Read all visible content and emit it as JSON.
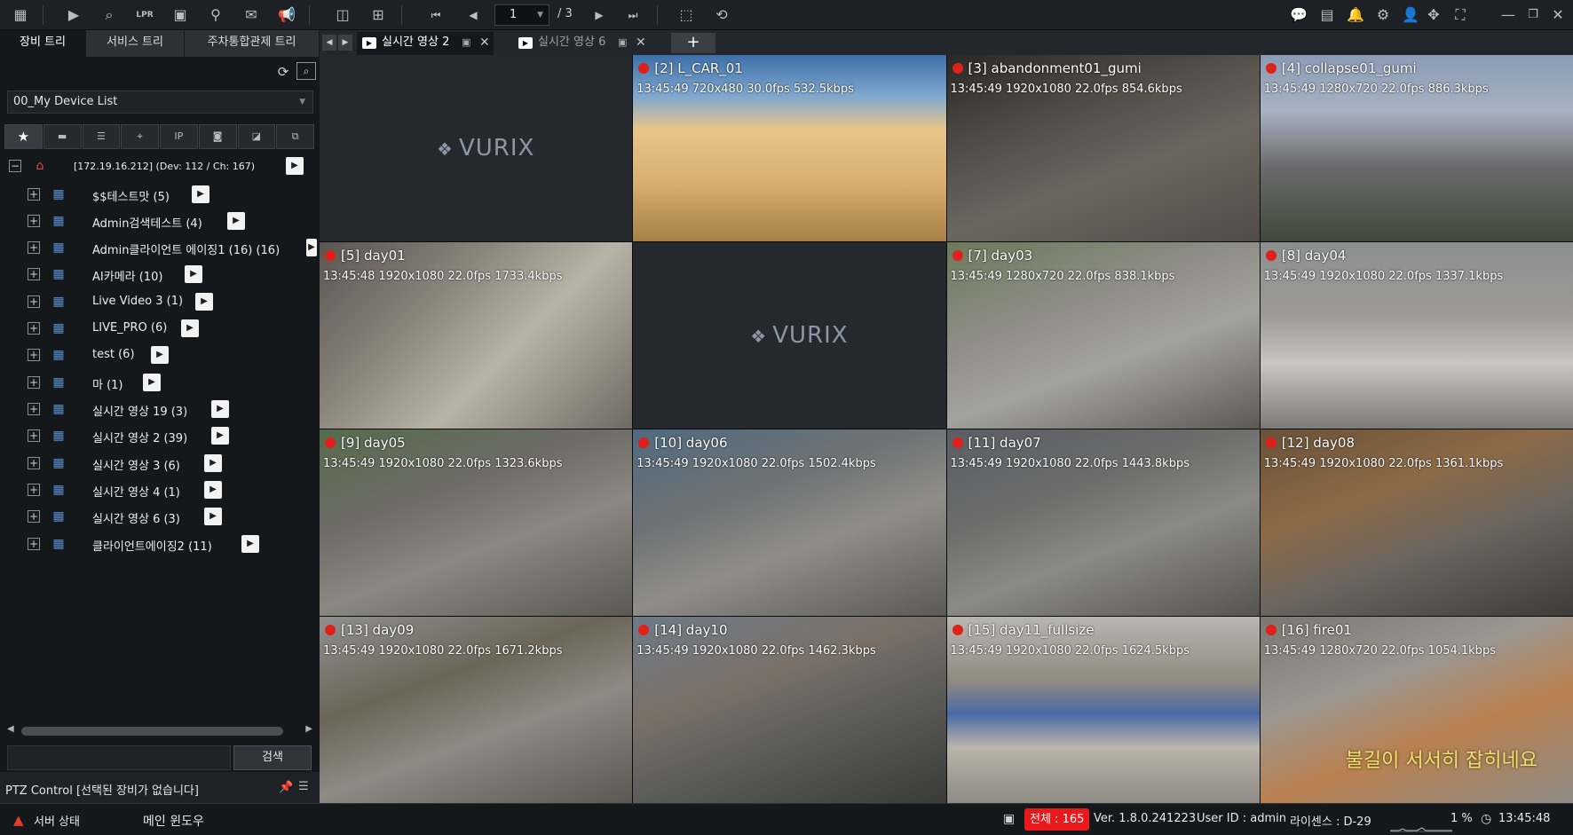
{
  "toolbar": {
    "page_current": "1",
    "page_total": "/ 3",
    "lpr_label": "LPR",
    "ip_label": "IP"
  },
  "left_tabs": [
    "장비 트리",
    "서비스 트리",
    "주차통합관제 트리"
  ],
  "device_list": {
    "selected": "00_My Device List"
  },
  "tree": {
    "root": "[172.19.16.212] (Dev: 112 / Ch: 167)",
    "items": [
      "$$테스트맛 (5)",
      "Admin검색테스트 (4)",
      "Admin클라이언트 에이징1 (16) (16)",
      "AI카메라 (10)",
      "Live Video 3 (1)",
      "LIVE_PRO (6)",
      "test (6)",
      "마 (1)",
      "실시간 영상 19 (3)",
      "실시간 영상 2 (39)",
      "실시간 영상 3 (6)",
      "실시간 영상 4 (1)",
      "실시간 영상 6 (3)",
      "클라이언트에이징2 (11)"
    ]
  },
  "search": {
    "value": "",
    "button": "검색"
  },
  "ptz": {
    "label": "PTZ Control [선택된 장비가 없습니다]"
  },
  "video_tabs": [
    {
      "title": "실시간 영상 2",
      "active": true
    },
    {
      "title": "실시간 영상 6",
      "active": false
    }
  ],
  "grid": {
    "logo": "VURIX",
    "cells": [
      {
        "title": "",
        "info": ""
      },
      {
        "title": "[2] L_CAR_01",
        "info": "13:45:49 720x480 30.0fps 532.5kbps"
      },
      {
        "title": "[3] abandonment01_gumi",
        "info": "13:45:49 1920x1080 22.0fps 854.6kbps"
      },
      {
        "title": "[4] collapse01_gumi",
        "info": "13:45:49 1280x720 22.0fps 886.3kbps"
      },
      {
        "title": "[5] day01",
        "info": "13:45:48 1920x1080 22.0fps 1733.4kbps"
      },
      {
        "title": "",
        "info": ""
      },
      {
        "title": "[7] day03",
        "info": "13:45:49 1280x720 22.0fps 838.1kbps"
      },
      {
        "title": "[8] day04",
        "info": "13:45:49 1920x1080 22.0fps 1337.1kbps"
      },
      {
        "title": "[9] day05",
        "info": "13:45:49 1920x1080 22.0fps 1323.6kbps"
      },
      {
        "title": "[10] day06",
        "info": "13:45:49 1920x1080 22.0fps 1502.4kbps"
      },
      {
        "title": "[11] day07",
        "info": "13:45:49 1920x1080 22.0fps 1443.8kbps"
      },
      {
        "title": "[12] day08",
        "info": "13:45:49 1920x1080 22.0fps 1361.1kbps"
      },
      {
        "title": "[13] day09",
        "info": "13:45:49 1920x1080 22.0fps 1671.2kbps"
      },
      {
        "title": "[14] day10",
        "info": "13:45:49 1920x1080 22.0fps 1462.3kbps"
      },
      {
        "title": "[15] day11_fullsize",
        "info": "13:45:49 1920x1080 22.0fps 1624.5kbps"
      },
      {
        "title": "[16] fire01",
        "info": "13:45:49 1280x720 22.0fps 1054.1kbps"
      }
    ],
    "fire_caption": "불길이 서서히 잡히네요"
  },
  "status": {
    "server": "서버 상태",
    "window": "메인 윈도우",
    "total": "전체 : 165",
    "version": "Ver. 1.8.0.241223",
    "user": "User ID : admin",
    "license": "라이센스 : D-29",
    "cpu": "1 %",
    "time": "13:45:48"
  },
  "colors": {
    "accent_red": "#e8181b",
    "panel": "#15181b",
    "toolbar": "#1d2126"
  }
}
